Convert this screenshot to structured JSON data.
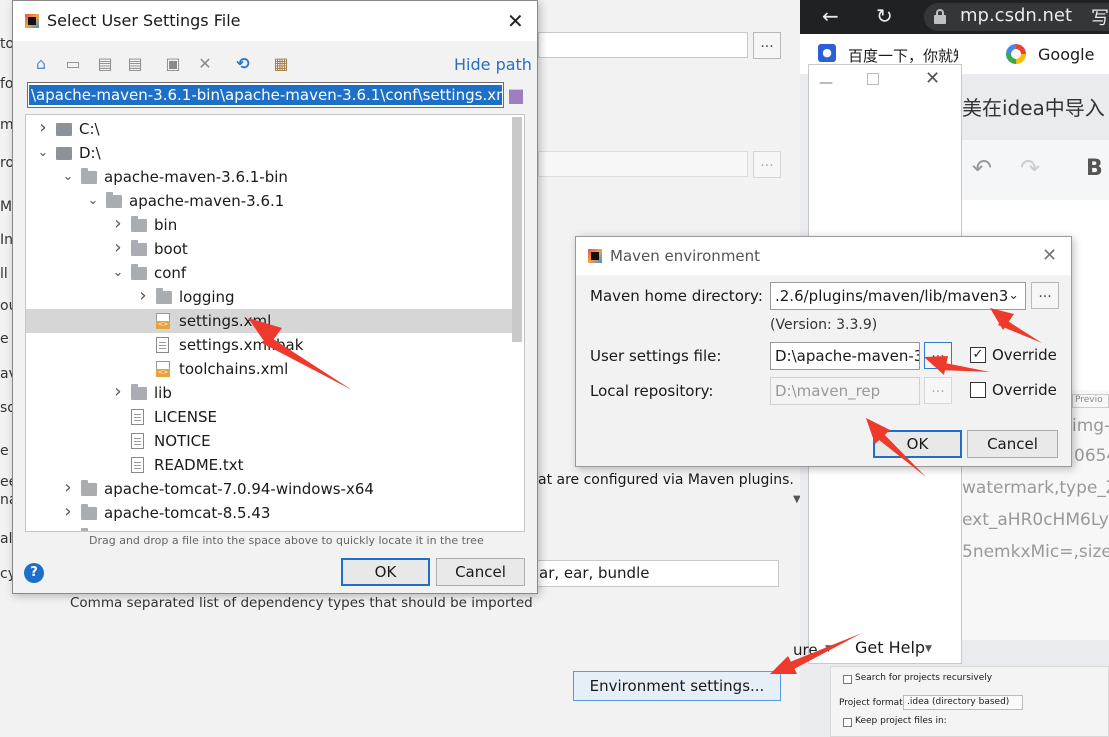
{
  "background_dialog": {
    "edge_fragments": [
      "to",
      "fo",
      "ma",
      "ro",
      "M",
      "In",
      "ll",
      "ou",
      "e l",
      "av",
      "so",
      "e u",
      "ee",
      "nat",
      "all",
      "cy"
    ],
    "maven_plugins_text": "at are configured via Maven plugins.",
    "dependency_types_value": "ar, ear, bundle",
    "dependency_types_hint": "Comma separated list of dependency types that should be imported",
    "environment_settings_button": "Environment settings...",
    "dots_label": "...",
    "get_help": "Get Help",
    "partial_button": "ure"
  },
  "browser": {
    "url": "mp.csdn.net",
    "tab_fragment": "写",
    "bookmarks": [
      {
        "label": "百度一下，你就知道",
        "icon": "paw-icon"
      },
      {
        "label": "Google",
        "icon": "google-icon"
      }
    ],
    "page_title_fragment": "美在idea中导入",
    "bold_label": "B",
    "image_url_fragments": [
      "img-",
      "0654",
      "watermark,type_Z",
      "ext_aHR0cHM6Ly",
      "5nemkxMic=,size_"
    ],
    "preview_label": "Previo",
    "options": [
      "Search for projects recursively",
      "Project format:",
      ".idea (directory based)",
      "Keep project files in:"
    ]
  },
  "file_dialog": {
    "title": "Select User Settings File",
    "hide_path": "Hide path",
    "path": "\\apache-maven-3.6.1-bin\\apache-maven-3.6.1\\conf\\settings.xml",
    "tree": [
      {
        "label": "C:\\",
        "type": "drive",
        "depth": 0,
        "expanded": false,
        "has_children": true
      },
      {
        "label": "D:\\",
        "type": "drive",
        "depth": 0,
        "expanded": true,
        "has_children": true
      },
      {
        "label": "apache-maven-3.6.1-bin",
        "type": "folder",
        "depth": 1,
        "expanded": true,
        "has_children": true
      },
      {
        "label": "apache-maven-3.6.1",
        "type": "folder",
        "depth": 2,
        "expanded": true,
        "has_children": true
      },
      {
        "label": "bin",
        "type": "folder",
        "depth": 3,
        "expanded": false,
        "has_children": true
      },
      {
        "label": "boot",
        "type": "folder",
        "depth": 3,
        "expanded": false,
        "has_children": true
      },
      {
        "label": "conf",
        "type": "folder",
        "depth": 3,
        "expanded": true,
        "has_children": true
      },
      {
        "label": "logging",
        "type": "folder",
        "depth": 4,
        "expanded": false,
        "has_children": true
      },
      {
        "label": "settings.xml",
        "type": "xml",
        "depth": 4,
        "selected": true
      },
      {
        "label": "settings.xml.bak",
        "type": "file",
        "depth": 4
      },
      {
        "label": "toolchains.xml",
        "type": "xml",
        "depth": 4
      },
      {
        "label": "lib",
        "type": "folder",
        "depth": 3,
        "expanded": false,
        "has_children": true
      },
      {
        "label": "LICENSE",
        "type": "file",
        "depth": 3
      },
      {
        "label": "NOTICE",
        "type": "file",
        "depth": 3
      },
      {
        "label": "README.txt",
        "type": "file",
        "depth": 3
      },
      {
        "label": "apache-tomcat-7.0.94-windows-x64",
        "type": "folder",
        "depth": 1,
        "expanded": false,
        "has_children": true
      },
      {
        "label": "apache-tomcat-8.5.43",
        "type": "folder",
        "depth": 1,
        "expanded": false,
        "has_children": true
      },
      {
        "label": "...",
        "type": "folder",
        "depth": 1,
        "expanded": false,
        "has_children": true
      }
    ],
    "hint": "Drag and drop a file into the space above to quickly locate it in the tree",
    "ok": "OK",
    "cancel": "Cancel",
    "help": "?"
  },
  "maven_dialog": {
    "title": "Maven environment",
    "home_label": "Maven home directory:",
    "home_value": ".2.6/plugins/maven/lib/maven3",
    "version": "(Version: 3.3.9)",
    "user_settings_label": "User settings file:",
    "user_settings_value": "D:\\apache-maven-3",
    "local_repo_label": "Local repository:",
    "local_repo_value": "D:\\maven_rep",
    "override_label": "Override",
    "override_settings_checked": true,
    "override_repo_checked": false,
    "ok": "OK",
    "cancel": "Cancel",
    "dots": "..."
  },
  "colors": {
    "accent": "#1e6fc8",
    "arrow": "#ee3a2c"
  }
}
